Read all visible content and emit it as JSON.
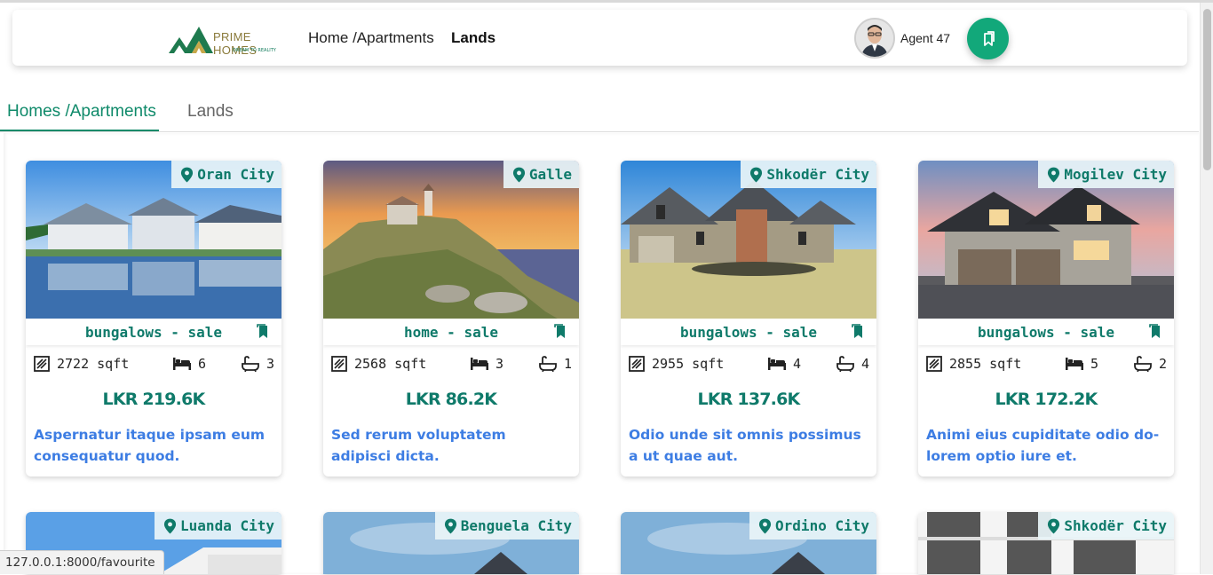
{
  "navbar": {
    "brand": "PRIME HOMES",
    "tagline": "DREAM TO REALITY",
    "links": [
      "Home /Apartments",
      "Lands"
    ],
    "agent_name": "Agent 47",
    "accent": "#12a87a"
  },
  "tabs": [
    "Homes /Apartments",
    "Lands"
  ],
  "cards": [
    {
      "location": "Oran City",
      "type": "bungalows - sale",
      "sqft": "2722 sqft",
      "beds": "6",
      "baths": "3",
      "price": "LKR 219.6K",
      "title": "Aspernatur itaque ipsam eum consequatur quod."
    },
    {
      "location": "Galle",
      "type": "home - sale",
      "sqft": "2568 sqft",
      "beds": "3",
      "baths": "1",
      "price": "LKR 86.2K",
      "title": "Sed rerum voluptatem adipisci dicta."
    },
    {
      "location": "Shkodër City",
      "type": "bungalows - sale",
      "sqft": "2955 sqft",
      "beds": "4",
      "baths": "4",
      "price": "LKR 137.6K",
      "title": "Odio unde sit omnis possimus a ut quae aut."
    },
    {
      "location": "Mogilev City",
      "type": "bungalows - sale",
      "sqft": "2855 sqft",
      "beds": "5",
      "baths": "2",
      "price": "LKR 172.2K",
      "title": "Animi eius cupiditate odio do-lorem optio iure et."
    }
  ],
  "cards_row2": [
    {
      "location": "Luanda City"
    },
    {
      "location": "Benguela City"
    },
    {
      "location": "Ordino City"
    },
    {
      "location": "Shkodër City"
    }
  ],
  "status_url": "127.0.0.1:8000/favourite"
}
